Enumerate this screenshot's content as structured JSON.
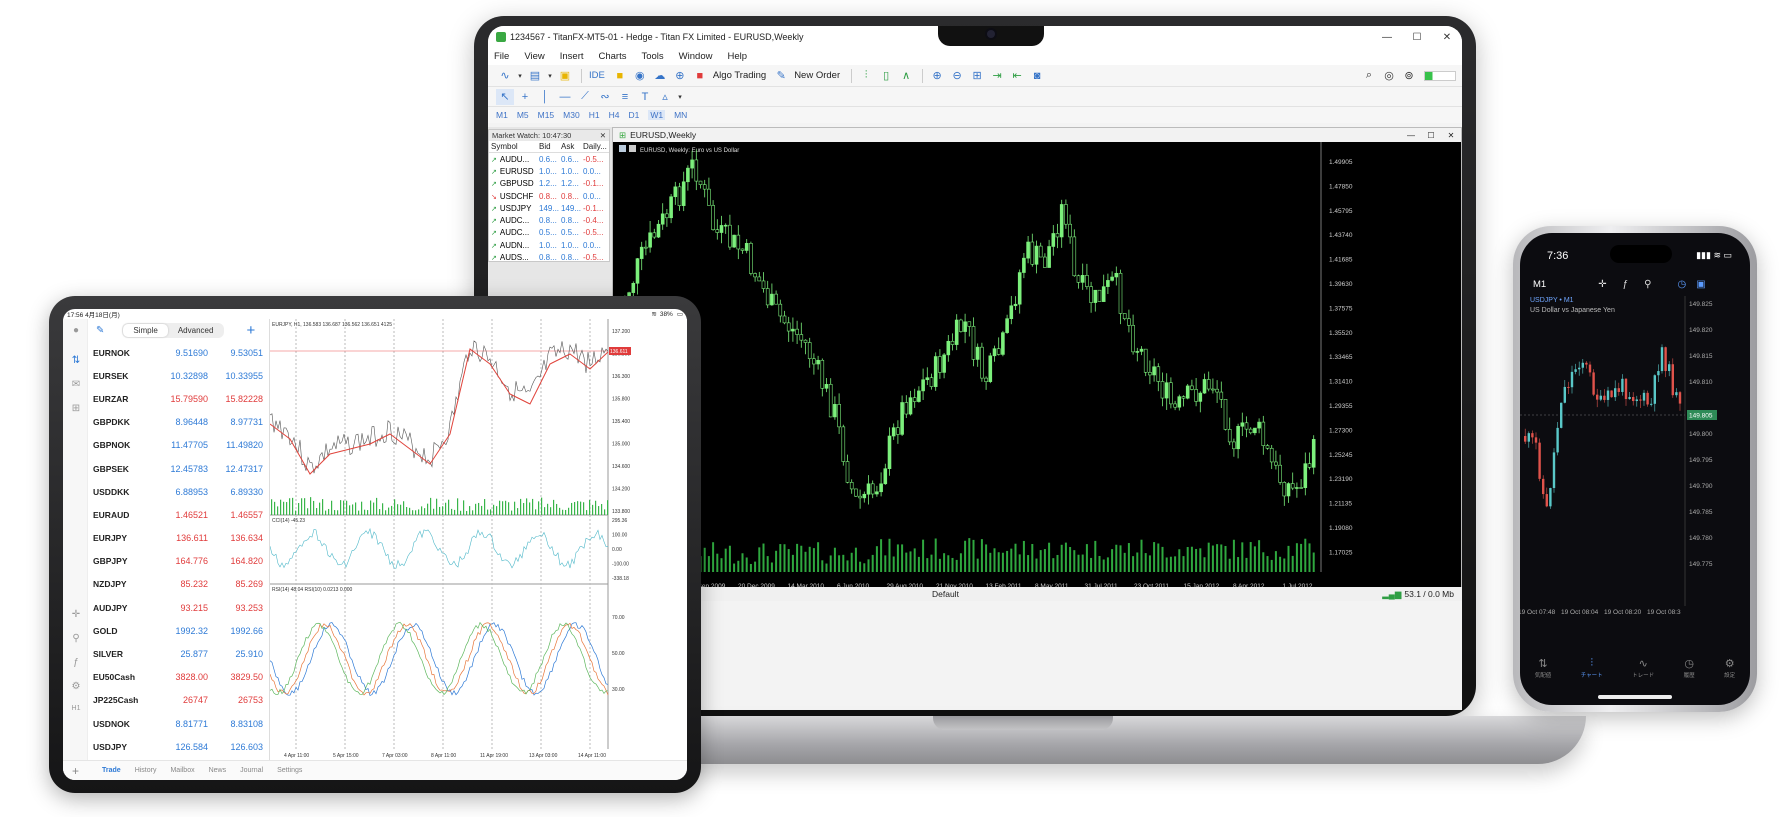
{
  "laptop": {
    "title": "1234567 - TitanFX-MT5-01 - Hedge - Titan FX Limited - EURUSD,Weekly",
    "menu": [
      "File",
      "View",
      "Insert",
      "Charts",
      "Tools",
      "Window",
      "Help"
    ],
    "toolbar": {
      "ide": "IDE",
      "algo": "Algo Trading",
      "new_order": "New Order"
    },
    "timeframes": [
      "M1",
      "M5",
      "M15",
      "M30",
      "H1",
      "H4",
      "D1",
      "W1",
      "MN"
    ],
    "selected_timeframe": "W1",
    "market_watch": {
      "title": "Market Watch: 10:47:30",
      "columns": [
        "Symbol",
        "Bid",
        "Ask",
        "Daily..."
      ],
      "rows": [
        {
          "symbol": "AUDU...",
          "bid": "0.6...",
          "ask": "0.6...",
          "daily": "-0.5...",
          "dir": "up"
        },
        {
          "symbol": "EURUSD",
          "bid": "1.0...",
          "ask": "1.0...",
          "daily": "0.0...",
          "dir": "up"
        },
        {
          "symbol": "GBPUSD",
          "bid": "1.2...",
          "ask": "1.2...",
          "daily": "-0.1...",
          "dir": "up"
        },
        {
          "symbol": "USDCHF",
          "bid": "0.8...",
          "ask": "0.8...",
          "daily": "0.0...",
          "dir": "dn"
        },
        {
          "symbol": "USDJPY",
          "bid": "149...",
          "ask": "149...",
          "daily": "-0.1...",
          "dir": "up"
        },
        {
          "symbol": "AUDC...",
          "bid": "0.8...",
          "ask": "0.8...",
          "daily": "-0.4...",
          "dir": "up"
        },
        {
          "symbol": "AUDC...",
          "bid": "0.5...",
          "ask": "0.5...",
          "daily": "-0.5...",
          "dir": "up"
        },
        {
          "symbol": "AUDN...",
          "bid": "1.0...",
          "ask": "1.0...",
          "daily": "0.0...",
          "dir": "up"
        },
        {
          "symbol": "AUDS...",
          "bid": "0.8...",
          "ask": "0.8...",
          "daily": "-0.5...",
          "dir": "up"
        }
      ]
    },
    "chart_window": {
      "title": "EURUSD,Weekly",
      "caption": "EURUSD, Weekly: Euro vs US Dollar"
    },
    "status": {
      "profile": "Default",
      "connection": "53.1 / 0.0 Mb"
    }
  },
  "tablet": {
    "status_left": "17:56  4月18日(月)",
    "status_right": "38%",
    "tabs": [
      "Simple",
      "Advanced"
    ],
    "active_tab": "Simple",
    "quotes": [
      {
        "symbol": "EURNOK",
        "bid": "9.51690",
        "ask": "9.53051",
        "dir": "up"
      },
      {
        "symbol": "EURSEK",
        "bid": "10.32898",
        "ask": "10.33955",
        "dir": "up"
      },
      {
        "symbol": "EURZAR",
        "bid": "15.79590",
        "ask": "15.82228",
        "dir": "dn"
      },
      {
        "symbol": "GBPDKK",
        "bid": "8.96448",
        "ask": "8.97731",
        "dir": "up"
      },
      {
        "symbol": "GBPNOK",
        "bid": "11.47705",
        "ask": "11.49820",
        "dir": "up"
      },
      {
        "symbol": "GBPSEK",
        "bid": "12.45783",
        "ask": "12.47317",
        "dir": "up"
      },
      {
        "symbol": "USDDKK",
        "bid": "6.88953",
        "ask": "6.89330",
        "dir": "up"
      },
      {
        "symbol": "EURAUD",
        "bid": "1.46521",
        "ask": "1.46557",
        "dir": "dn"
      },
      {
        "symbol": "EURJPY",
        "bid": "136.611",
        "ask": "136.634",
        "dir": "dn"
      },
      {
        "symbol": "GBPJPY",
        "bid": "164.776",
        "ask": "164.820",
        "dir": "dn"
      },
      {
        "symbol": "NZDJPY",
        "bid": "85.232",
        "ask": "85.269",
        "dir": "dn"
      },
      {
        "symbol": "AUDJPY",
        "bid": "93.215",
        "ask": "93.253",
        "dir": "dn"
      },
      {
        "symbol": "GOLD",
        "bid": "1992.32",
        "ask": "1992.66",
        "dir": "up"
      },
      {
        "symbol": "SILVER",
        "bid": "25.877",
        "ask": "25.910",
        "dir": "up"
      },
      {
        "symbol": "EU50Cash",
        "bid": "3828.00",
        "ask": "3829.50",
        "dir": "dn"
      },
      {
        "symbol": "JP225Cash",
        "bid": "26747",
        "ask": "26753",
        "dir": "dn"
      },
      {
        "symbol": "USDNOK",
        "bid": "8.81771",
        "ask": "8.83108",
        "dir": "up"
      },
      {
        "symbol": "USDJPY",
        "bid": "126.584",
        "ask": "126.603",
        "dir": "up"
      }
    ],
    "chart": {
      "header": "EURJPY, H1, 136.583 136.687 136.562 136.651 4125",
      "price_labels": [
        "137.200",
        "136.800",
        "136.300",
        "135.800",
        "135.400",
        "135.000",
        "134.600",
        "134.200",
        "133.800"
      ],
      "cci_label": "CCI(14) -45.23",
      "cci_levels": [
        "295.36",
        "100.00",
        "0.00",
        "-100.00",
        "-338.18"
      ],
      "rsi_label": "RSI(14) 48.04 RSI(10) 0.0213 0.000",
      "rsi_levels": [
        "70.00",
        "50.00",
        "30.00"
      ],
      "dates": [
        "4 Apr 11:00",
        "5 Apr 15:00",
        "7 Apr 03:00",
        "8 Apr 11:00",
        "11 Apr 19:00",
        "13 Apr 03:00",
        "14 Apr 11:00"
      ],
      "current_price": "136.611"
    },
    "bottom_tabs": [
      "Trade",
      "History",
      "Mailbox",
      "News",
      "Journal",
      "Settings"
    ],
    "active_bottom": "Trade",
    "timeframe": "H1"
  },
  "phone": {
    "time": "7:36",
    "timeframe": "M1",
    "symbol": "USDJPY • M1",
    "description": "US Dollar vs Japanese Yen",
    "price_labels": [
      "149.825",
      "149.820",
      "149.815",
      "149.810",
      "149.800",
      "149.795",
      "149.790",
      "149.785",
      "149.780",
      "149.775"
    ],
    "current_price": "149.805",
    "time_labels": [
      "19 Oct 07:48",
      "19 Oct 08:04",
      "19 Oct 08:20",
      "19 Oct 08:3"
    ],
    "nav": [
      "気配値",
      "チャート",
      "トレード",
      "履歴",
      "設定"
    ],
    "active_nav": "チャート"
  },
  "colors": {
    "bull": "#7cf07c",
    "bear": "#e0433b",
    "accent": "#2e7ad6"
  }
}
